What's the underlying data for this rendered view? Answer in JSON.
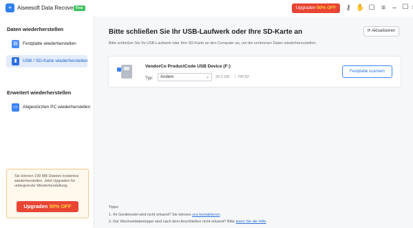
{
  "titlebar": {
    "app_title": "Aiseesoft Data Recovery",
    "free_badge": "Free",
    "upgrade_label": "Upgraden",
    "upgrade_percent": "50% OFF",
    "icons": [
      "key-icon",
      "paw-icon",
      "chat-icon",
      "menu-icon",
      "minimize-icon",
      "maximize-icon",
      "close-icon"
    ]
  },
  "sidebar": {
    "section1_title": "Daten wiederherstellen",
    "items": [
      {
        "label": "Festplatte wiederherstellen",
        "icon": "hard-drive-icon",
        "color": "#4a8cf7"
      },
      {
        "label": "USB / SD-Karte wiederherstellen",
        "icon": "usb-sd-icon",
        "color": "#2f6fe0",
        "active": true
      }
    ],
    "section2_title": "Erweitert wiederherstellen",
    "items2": [
      {
        "label": "Abgestürzten PC wiederherstellen",
        "icon": "crashed-pc-icon",
        "color": "#3b82f6"
      }
    ],
    "promo": {
      "text": "Sie können 199 MB Dateien kostenlos wiederherstellen. Jetzt Upgraden für unbegrenzte Wiederherstellung.",
      "button_label": "Upgraden",
      "button_percent": "50% OFF"
    }
  },
  "main": {
    "title": "Bitte schließen Sie Ihr USB-Laufwerk oder Ihre SD-Karte an",
    "subtitle": "Bitte schließen Sie Ihr USB-Laufwerk oder Ihre SD-Karte an den Computer an, um die verlorenen Daten wiederherzustellen.",
    "refresh_label": "Aktualisieren",
    "device": {
      "name": "VendorCo ProductCode USB Device (F:)",
      "type_label": "Typ:",
      "type_value": "Andere",
      "size": "29.2 GB",
      "filesystem": "FAT32",
      "scan_label": "Festplatte scannen"
    },
    "tips": {
      "heading": "Tipps:",
      "tip1_text": "1. Ihr Gerätmodel wird nicht erkannt? Sie können",
      "tip1_link": "uns kontaktieren",
      "tip1_end": ".",
      "tip2_text": "2. Der Wechseldatenträger wird nach dem Anschließen nicht erkannt? Bitte",
      "tip2_link": "lesen Sie die Hilfe",
      "tip2_end": "."
    }
  },
  "colors": {
    "accent": "#2b6fd8",
    "upgrade": "#e84534",
    "badge": "#3cc05e"
  }
}
